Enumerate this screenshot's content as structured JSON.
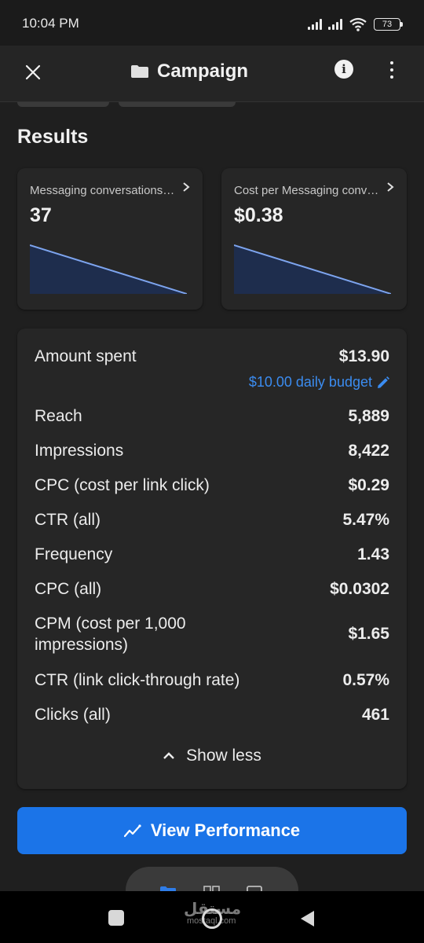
{
  "status_bar": {
    "time": "10:04 PM",
    "battery": "73",
    "icons": [
      "signal-icon",
      "signal-icon",
      "wifi-icon",
      "battery-icon"
    ]
  },
  "app_bar": {
    "title": "Campaign",
    "icons": [
      "close-icon",
      "folder-icon",
      "info-icon",
      "more-vertical-icon"
    ]
  },
  "results": {
    "title": "Results",
    "metrics": [
      {
        "label": "Messaging conversations started",
        "value": "37",
        "trend": "down"
      },
      {
        "label": "Cost per Messaging conversation started",
        "value": "$0.38",
        "trend": "down"
      }
    ]
  },
  "stats": {
    "amount_spent_label": "Amount spent",
    "amount_spent_value": "$13.90",
    "budget_link": "$10.00 daily budget",
    "rows": [
      {
        "label": "Reach",
        "value": "5,889"
      },
      {
        "label": "Impressions",
        "value": "8,422"
      },
      {
        "label": "CPC (cost per link click)",
        "value": "$0.29"
      },
      {
        "label": "CTR (all)",
        "value": "5.47%"
      },
      {
        "label": "Frequency",
        "value": "1.43"
      },
      {
        "label": "CPC (all)",
        "value": "$0.0302"
      },
      {
        "label": "CPM (cost per 1,000 impressions)",
        "value": "$1.65"
      },
      {
        "label": "CTR (link click-through rate)",
        "value": "0.57%"
      },
      {
        "label": "Clicks (all)",
        "value": "461"
      }
    ],
    "toggle_label": "Show less"
  },
  "actions": {
    "view_performance": "View Performance"
  },
  "watermark": {
    "text": "مستقل",
    "sub": "mostaql.com"
  },
  "colors": {
    "background": "#1f1f1f",
    "card": "#262626",
    "accent_blue": "#1b74e8",
    "link_blue": "#3b8cf0",
    "spark_line": "#7da4ee",
    "spark_fill": "#1e2d4d"
  }
}
